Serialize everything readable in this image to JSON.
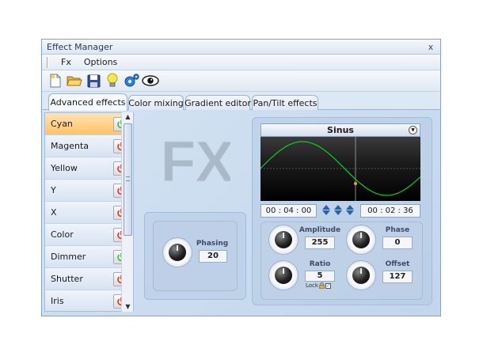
{
  "window": {
    "title": "Effect Manager",
    "close": "x"
  },
  "menu": [
    {
      "label": "Fx"
    },
    {
      "label": "Options"
    }
  ],
  "toolbar": [
    "new-file-icon",
    "open-folder-icon",
    "save-icon",
    "lightbulb-icon",
    "settings-gear-icon",
    "eye-icon"
  ],
  "tabs": [
    {
      "label": "Advanced effects",
      "active": true
    },
    {
      "label": "Color mixing",
      "active": false
    },
    {
      "label": "Gradient editor",
      "active": false
    },
    {
      "label": "Pan/Tilt effects",
      "active": false
    }
  ],
  "channels": [
    {
      "label": "Cyan",
      "selected": true,
      "power": "on"
    },
    {
      "label": "Magenta",
      "selected": false,
      "power": "off"
    },
    {
      "label": "Yellow",
      "selected": false,
      "power": "off"
    },
    {
      "label": "Y",
      "selected": false,
      "power": "off"
    },
    {
      "label": "X",
      "selected": false,
      "power": "off"
    },
    {
      "label": "Color",
      "selected": false,
      "power": "off"
    },
    {
      "label": "Dimmer",
      "selected": false,
      "power": "on"
    },
    {
      "label": "Shutter",
      "selected": false,
      "power": "off"
    },
    {
      "label": "Iris",
      "selected": false,
      "power": "off"
    }
  ],
  "logo": {
    "text": "FX"
  },
  "phasing": {
    "label": "Phasing",
    "value": "20"
  },
  "wave": {
    "name": "Sinus",
    "time_left": "00 : 04 : 00",
    "time_right": "00 : 02 : 36",
    "params": {
      "amplitude": {
        "label": "Amplitude",
        "value": "255"
      },
      "phase": {
        "label": "Phase",
        "value": "0"
      },
      "ratio": {
        "label": "Ratio",
        "value": "5"
      },
      "offset": {
        "label": "Offset",
        "value": "127"
      }
    },
    "lock_label": "Lock"
  },
  "colors": {
    "selected_row": "#ffc266",
    "wave_line": "#00d21e",
    "power_off": "#e0322c",
    "power_on": "#3cb84a",
    "marker": "#ff9e1a"
  }
}
